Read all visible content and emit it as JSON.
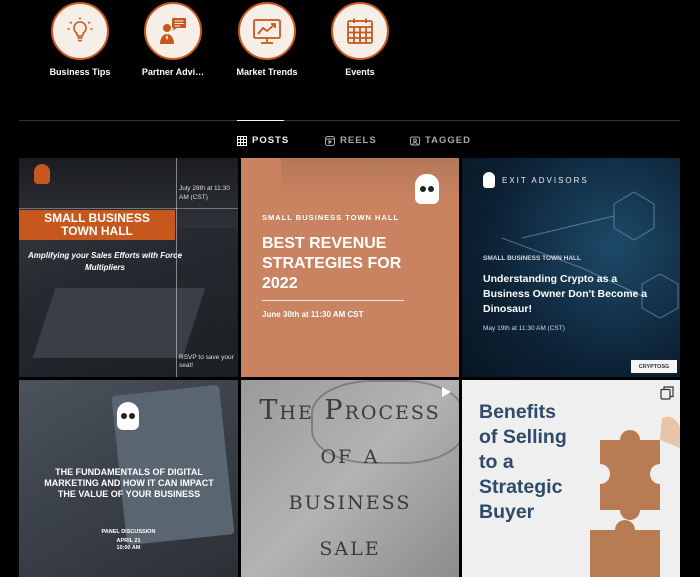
{
  "highlights": [
    {
      "label": "Business Tips",
      "icon": "lightbulb-icon"
    },
    {
      "label": "Partner Advi…",
      "icon": "advisor-icon"
    },
    {
      "label": "Market Trends",
      "icon": "chart-monitor-icon"
    },
    {
      "label": "Events",
      "icon": "calendar-icon"
    }
  ],
  "tabs": [
    {
      "label": "POSTS",
      "icon": "grid-icon",
      "active": true
    },
    {
      "label": "REELS",
      "icon": "reels-icon",
      "active": false
    },
    {
      "label": "TAGGED",
      "icon": "tagged-icon",
      "active": false
    }
  ],
  "posts": {
    "p1": {
      "title_line1": "SMALL BUSINESS",
      "title_line2": "TOWN HALL",
      "subtitle": "Amplifying your Sales Efforts with Force Multipliers",
      "date": "July 28th at 11:30 AM (CST)",
      "rsvp": "RSVP to save your seat!"
    },
    "p2": {
      "kicker": "SMALL BUSINESS TOWN HALL",
      "title": "BEST REVENUE STRATEGIES FOR 2022",
      "date": "June 30th at 11:30 AM CST"
    },
    "p3": {
      "brand": "EXIT ADVISORS",
      "kicker": "SMALL BUSINESS TOWN HALL",
      "title": "Understanding Crypto as a Business Owner Don't Become a Dinosaur!",
      "date": "May 19th at 11:30 AM (CST)",
      "badge": "CRYPTOSG"
    },
    "p4": {
      "title": "THE FUNDAMENTALS OF DIGITAL MARKETING AND HOW IT CAN IMPACT THE VALUE OF YOUR BUSINESS",
      "kicker": "PANEL DISCUSSION",
      "date": "APRIL 21",
      "time": "10:00 AM"
    },
    "p5": {
      "title_line1": "The Process",
      "title_line2": "of a",
      "title_line3": "business",
      "title_line4": "sale"
    },
    "p6": {
      "title_line1": "Benefits",
      "title_line2": "of Selling",
      "title_line3": "to a",
      "title_line4": "Strategic",
      "title_line5": "Buyer"
    }
  },
  "colors": {
    "accent": "#c6581e",
    "orange_tile": "#c98360",
    "navy_tile": "#0d2236"
  }
}
